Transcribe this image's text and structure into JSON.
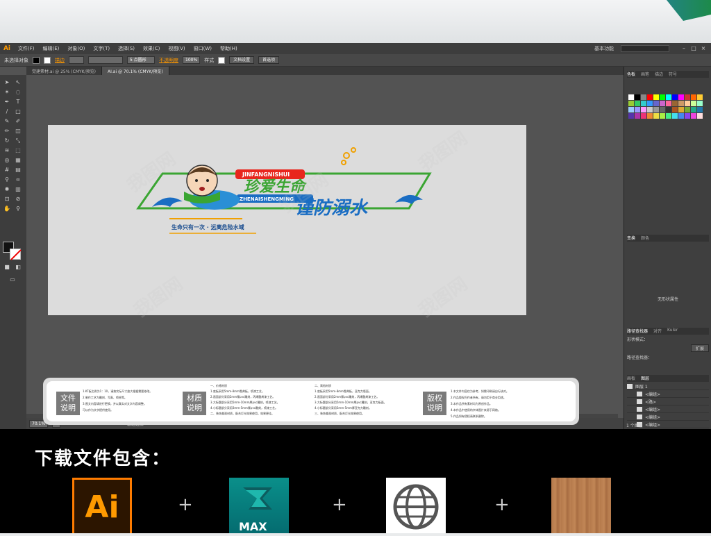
{
  "app": {
    "logo": "Ai",
    "menu": [
      "文件(F)",
      "编辑(E)",
      "对象(O)",
      "文字(T)",
      "选择(S)",
      "效果(C)",
      "视图(V)",
      "窗口(W)",
      "帮助(H)"
    ],
    "workspace": "基本功能"
  },
  "controlbar": {
    "selection": "未选择对象",
    "stroke_label": "描边",
    "point_size": "5 点圆形",
    "opacity_label": "不透明度",
    "opacity_value": "100%",
    "style_label": "样式",
    "doc_setup": "文档设置",
    "preferences": "首选项"
  },
  "tabs": [
    {
      "label": "觉建素材.ai @ 25% (CMYK/预览)"
    },
    {
      "label": "AI.ai @ 70.1% (CMYK/预览)"
    }
  ],
  "status": {
    "zoom": "70.1%",
    "page": "1",
    "tool": "编组选择"
  },
  "panels": {
    "swatch_tabs": [
      "色板",
      "画笔",
      "描边",
      "符号"
    ],
    "transform_tabs": [
      "变换",
      "颜色"
    ],
    "no_shape_text": "无形状属性",
    "pathfinder_tabs": [
      "路径查找器",
      "对齐",
      "Kuler"
    ],
    "shape_mode": "形状模式：",
    "expand": "扩展",
    "pathfinder": "路径查找器：",
    "layer_tabs": [
      "画板",
      "图层"
    ],
    "layers": [
      {
        "name": "图层 1"
      },
      {
        "name": "<编组>"
      },
      {
        "name": "<路>"
      },
      {
        "name": "<编组>"
      },
      {
        "name": "<编组>"
      },
      {
        "name": "<编组>"
      }
    ],
    "layer_count": "1 个图层"
  },
  "artwork": {
    "title_a": "珍爱生命",
    "title_b": "谨防溺水",
    "pinyin_a": "ZHENAISHENGMING",
    "pinyin_b": "JINFANGNISHUI",
    "slogan": "生命只有一次 · 远离危险水域"
  },
  "info": {
    "badge1": [
      "文件",
      "说明"
    ],
    "badge2": [
      "材质",
      "说明"
    ],
    "badge3": [
      "版权",
      "说明"
    ],
    "col1": [
      "1.KT板比例为1：10，请按实际尺寸放大根据需要修改。",
      "2.制作工艺为雕刻、写真、喷绘等。",
      "3.图文内容请进行更换，并以真实对文字内容调整。",
      "可以作为文字提供使用。"
    ],
    "col2": [
      "一、价格材质",
      "1.底板采用5mm-8mm雪弗板，喷漆工艺。",
      "2.画面部分采用2mm厚pvc雕刻，丙烯酸烤漆工艺。",
      "3.大标题部分采用5mm-10mm厚pvc雕刻，喷漆工艺。",
      "4.小标题部分采用3mm-5mm厚pvc雕刻，喷漆工艺。",
      "二、装饰美观材质，配合灯光效果使用，效果更佳。"
    ],
    "col3": [
      "二、高档材质",
      "1.底板采用5mm-8mm雪弗板，亚克力版面。",
      "2.画面部分采用2mm厚pvc雕刻，丙烯酸烤漆工艺。",
      "3.大标题部分采用5mm-10mm厚pvc雕刻，亚克力板面。",
      "4.小标题部分采用3mm-5mm厚亚克力雕刻。",
      "三、装饰美观材质，配合灯光效果使用。"
    ],
    "col4": [
      "1.本文件内容仅为参考，如需印刷请自行核对。",
      "2.作品版权归作者所有，请勿用于商业用途。",
      "3.本作品所有素材均为原创作品。",
      "4.本作品中使用的字体图片来源于网络。",
      "5.作品如有侵权请联系删除。"
    ]
  },
  "bottom": {
    "title": "下载文件包含：",
    "ai_label": "Ai",
    "max_label": "MAX",
    "plus": "+"
  },
  "colors": {
    "accent_orange": "#ff9a00",
    "title_red": "#e8261c",
    "title_green": "#3aa532",
    "title_blue": "#1a6dc3"
  }
}
